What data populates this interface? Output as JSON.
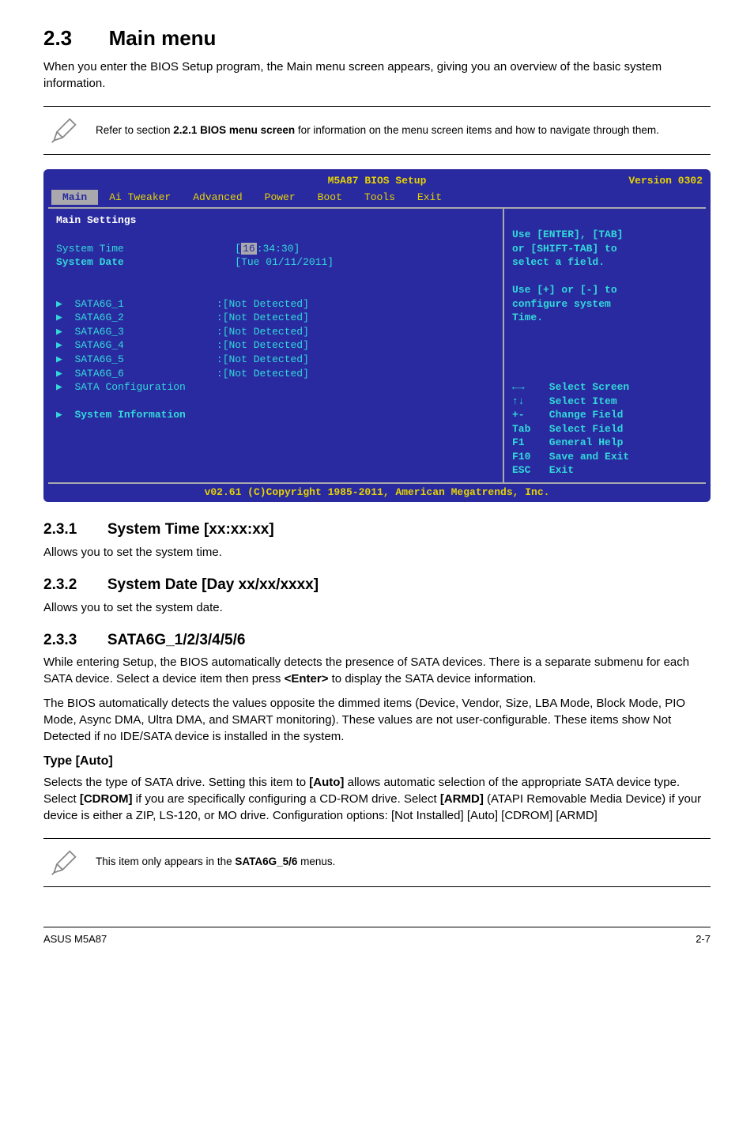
{
  "section": {
    "num_title": "2.3",
    "name": "Main menu"
  },
  "intro_p": "When you enter the BIOS Setup program, the Main menu screen appears, giving you an overview of the basic system information.",
  "note1": {
    "pre": "Refer to section ",
    "bold": "2.2.1 BIOS menu screen",
    "post": " for information on the menu screen items and how to navigate through them."
  },
  "bios": {
    "title": "M5A87 BIOS Setup",
    "version": "Version 0302",
    "tabs": [
      "Main",
      "Ai Tweaker",
      "Advanced",
      "Power",
      "Boot",
      "Tools",
      "Exit"
    ],
    "main_settings": "Main Settings",
    "sys_time_label": "System Time",
    "sys_time_val_open": "[",
    "sys_time_val_hi": "16",
    "sys_time_val_rest": ":34:30]",
    "sys_date_label": "System Date",
    "sys_date_val": "[Tue 01/11/2011]",
    "sata": [
      "SATA6G_1",
      "SATA6G_2",
      "SATA6G_3",
      "SATA6G_4",
      "SATA6G_5",
      "SATA6G_6"
    ],
    "sata_val": ":[Not Detected]",
    "sata_conf": "SATA Configuration",
    "sys_info": "System Information",
    "help1": "Use [ENTER], [TAB]\nor [SHIFT-TAB] to\nselect a field.",
    "help2": "Use [+] or [-] to\nconfigure system\nTime.",
    "nav_lines": [
      "←→    Select Screen",
      "↑↓    Select Item",
      "+-    Change Field",
      "Tab   Select Field",
      "F1    General Help",
      "F10   Save and Exit",
      "ESC   Exit"
    ],
    "footer": "v02.61 (C)Copyright 1985-2011, American Megatrends, Inc."
  },
  "s231": {
    "num_title": "2.3.1",
    "name": "System Time [xx:xx:xx]",
    "p": "Allows you to set the system time."
  },
  "s232": {
    "num_title": "2.3.2",
    "name": "System Date [Day xx/xx/xxxx]",
    "p": "Allows you to set the system date."
  },
  "s233": {
    "num_title": "2.3.3",
    "name": "SATA6G_1/2/3/4/5/6",
    "p1a": "While entering Setup, the BIOS automatically detects the presence of SATA devices. There is a separate submenu for each SATA device. Select a device item then press ",
    "p1b": "<Enter>",
    "p1c": " to display the SATA device information.",
    "p2": "The BIOS automatically detects the values opposite the dimmed items (Device, Vendor, Size, LBA Mode, Block Mode, PIO Mode, Async DMA, Ultra DMA, and SMART monitoring). These values are not user-configurable. These items show Not Detected if no IDE/SATA device is installed in the system."
  },
  "type_auto": {
    "heading": "Type [Auto]",
    "t1": "Selects the type of SATA drive. Setting this item to ",
    "b1": "[Auto]",
    "t2": " allows automatic selection of the appropriate SATA device type. Select ",
    "b2": "[CDROM]",
    "t3": " if you are specifically configuring a CD-ROM drive. Select ",
    "b3": "[ARMD]",
    "t4": " (ATAPI Removable Media Device) if your device is either a ZIP, LS-120, or MO drive. Configuration options: [Not Installed] [Auto] [CDROM] [ARMD]"
  },
  "note2": {
    "pre": "This item only appears in the ",
    "bold": "SATA6G_5/6",
    "post": " menus."
  },
  "footer": {
    "left": "ASUS M5A87",
    "right": "2-7"
  }
}
